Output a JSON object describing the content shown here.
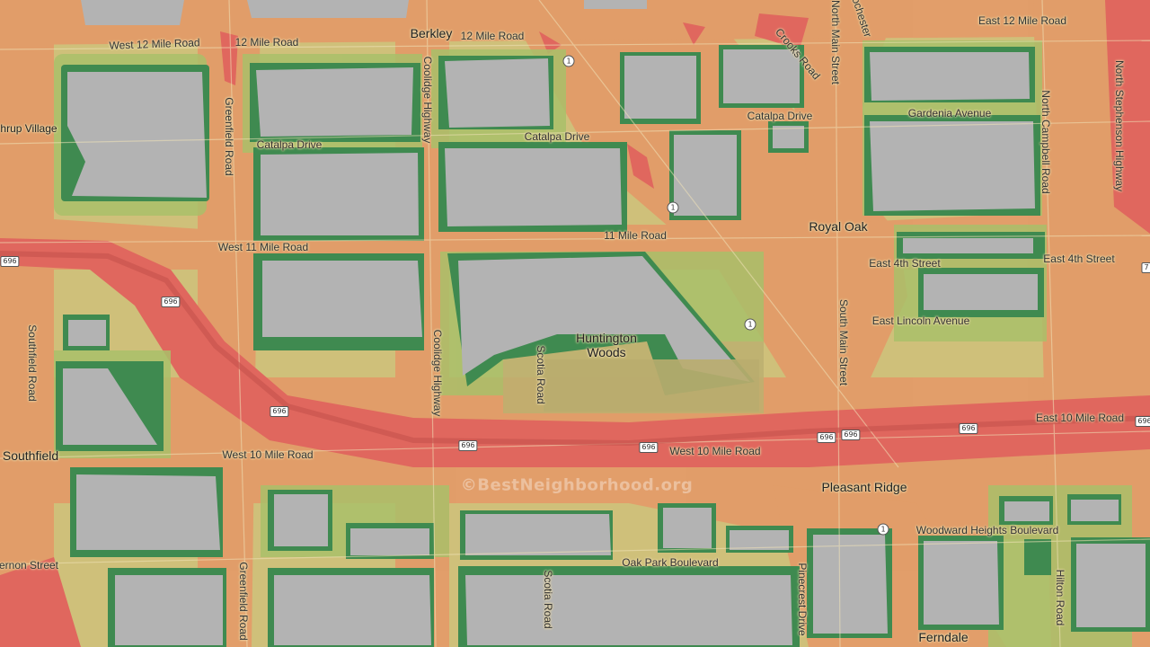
{
  "map": {
    "colors": {
      "base": "#c9b98a",
      "safe_green": "#3f8a50",
      "light_green": "#a9c06a",
      "yellow_olive": "#cfc07a",
      "orange": "#e39a68",
      "red": "#e0675e",
      "block_gray": "#b3b3b3"
    },
    "places": {
      "berkley": "Berkley",
      "royal_oak": "Royal Oak",
      "huntington_1": "Huntington",
      "huntington_2": "Woods",
      "southfield": "Southfield",
      "pleasant_ridge": "Pleasant Ridge",
      "ferndale": "Ferndale",
      "lathrup_village": "hrup Village"
    },
    "roads": {
      "west_12_mile": "West 12 Mile Road",
      "r12_mile_a": "12 Mile Road",
      "r12_mile_b": "12 Mile Road",
      "east_12_mile": "East 12 Mile Road",
      "crooks": "Crooks Road",
      "north_main": "North Main Street",
      "rochester": "Rochester",
      "coolidge_top": "Coolidge Highway",
      "coolidge_bottom": "Coolidge Highway",
      "greenfield_top": "Greenfield Road",
      "greenfield_bottom": "Greenfield Road",
      "catalpa_1": "Catalpa Drive",
      "catalpa_2": "Catalpa Drive",
      "catalpa_3": "Catalpa Drive",
      "gardenia": "Gardenia Avenue",
      "north_campbell": "North Campbell Road",
      "north_stephenson": "North Stephenson Highway",
      "west_11_mile": "West 11 Mile Road",
      "r11_mile": "11 Mile Road",
      "east_4th_a": "East 4th Street",
      "east_4th_b": "East 4th Street",
      "east_lincoln": "East Lincoln Avenue",
      "south_main": "South Main Street",
      "southfield_rd": "Southfield Road",
      "scotia_top": "Scotia Road",
      "scotia_bottom": "Scotia Road",
      "east_10_mile": "East 10 Mile Road",
      "west_10_mile_a": "West 10 Mile Road",
      "west_10_mile_b": "West 10 Mile Road",
      "woodward_heights": "Woodward Heights Boulevard",
      "oak_park": "Oak Park Boulevard",
      "pinecrest": "Pinecrest Drive",
      "hilton": "Hilton Road",
      "vernon": "ernon Street"
    },
    "shields": {
      "i696": "696",
      "m1": "1",
      "edge_7": "7"
    },
    "watermark": "©BestNeighborhood.org"
  }
}
